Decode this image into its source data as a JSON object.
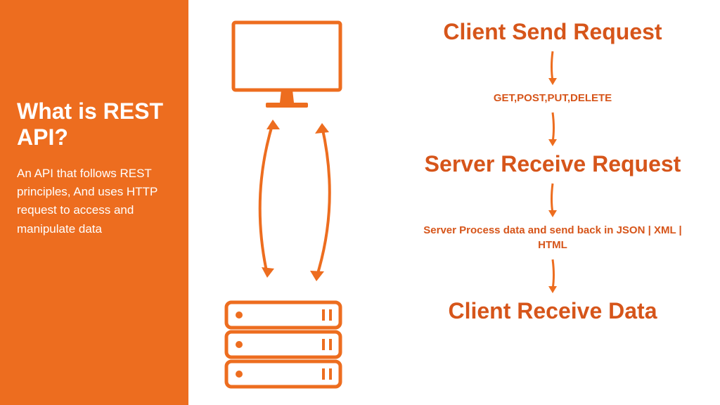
{
  "sidebar": {
    "title": "What is REST API?",
    "description": "An API that follows REST principles, And uses HTTP request to access and manipulate data"
  },
  "flow": {
    "step1": "Client Send Request",
    "sub1": "GET,POST,PUT,DELETE",
    "step2": "Server Receive Request",
    "sub2": "Server Process data and send back in JSON | XML | HTML",
    "step3": "Client Receive Data"
  }
}
